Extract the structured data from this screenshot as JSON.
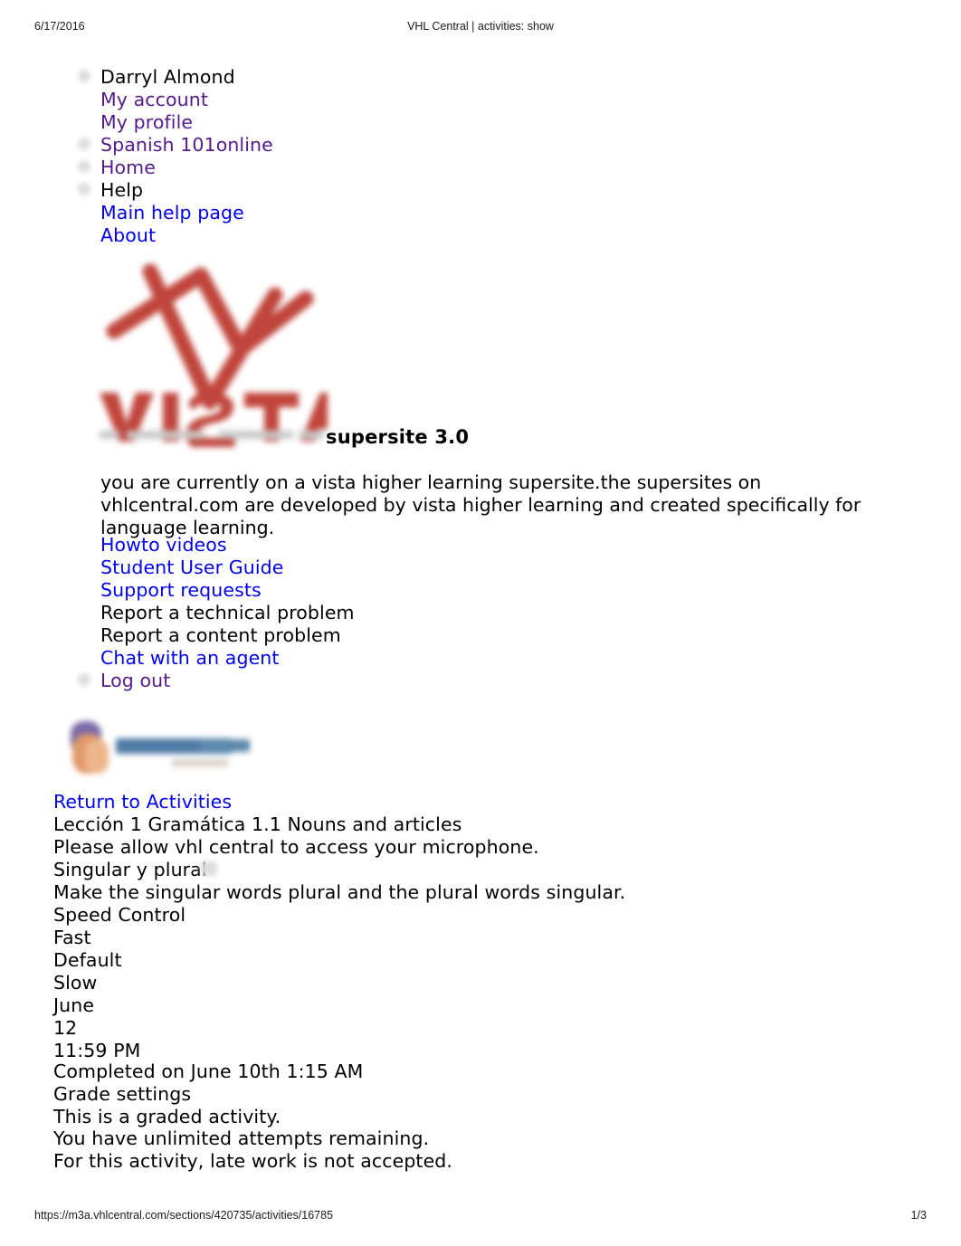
{
  "print_header": {
    "date": "6/17/2016",
    "title": "VHL Central | activities: show"
  },
  "print_footer": {
    "url": "https://m3a.vhlcentral.com/sections/420735/activities/16785",
    "page": "1/3"
  },
  "colors": {
    "link_unvisited": "#0000ee",
    "link_visited": "#551a8b",
    "text": "#000000",
    "logo_red": "#c0453c"
  },
  "nav": {
    "items": [
      {
        "label": "Darryl Almond",
        "kind": "text",
        "bullet": true
      },
      {
        "label": "My account",
        "kind": "visited",
        "bullet": false
      },
      {
        "label": "My profile",
        "kind": "visited",
        "bullet": false
      },
      {
        "label": "Spanish 101online",
        "kind": "visited",
        "bullet": true
      },
      {
        "label": "Home",
        "kind": "visited",
        "bullet": true
      },
      {
        "label": "Help",
        "kind": "text",
        "bullet": true
      },
      {
        "label": "Main help page",
        "kind": "link",
        "bullet": false
      },
      {
        "label": "About",
        "kind": "link",
        "bullet": false
      }
    ]
  },
  "brand": {
    "logo_name": "vista-higher-learning-logo",
    "wordmark": "VISTA",
    "supersite_label": "supersite 3.0",
    "description": "you are currently on a vista higher learning supersite.the supersites on vhlcentral.com are developed by vista higher learning and created specifically for language learning."
  },
  "support": {
    "items": [
      {
        "label": "Howto videos",
        "kind": "link"
      },
      {
        "label": "Student User Guide",
        "kind": "link"
      },
      {
        "label": "Support requests",
        "kind": "link"
      },
      {
        "label": "Report a technical problem",
        "kind": "text"
      },
      {
        "label": "Report a content problem",
        "kind": "text"
      },
      {
        "label": "Chat with an agent",
        "kind": "link"
      },
      {
        "label": "Log out",
        "kind": "visited",
        "bullet": true
      }
    ]
  },
  "activity": {
    "badge_name": "course-badge-image",
    "return_link": "Return to Activities",
    "breadcrumb": "Lección 1 Gramática 1.1 Nouns and articles",
    "mic_notice": "Please allow vhl central to access your microphone.",
    "title": "Singular y plural",
    "instructions": "Make the singular words plural and the plural words singular.",
    "speed_control": {
      "label": "Speed Control",
      "options": [
        "Fast",
        "Default",
        "Slow"
      ]
    },
    "due": {
      "month": "June",
      "day": "12",
      "time": "11:59 PM"
    },
    "completed": "Completed on June 10th 1:15 AM",
    "grade_settings": {
      "label": "Grade settings",
      "graded": "This is a graded activity.",
      "attempts": "You have unlimited attempts remaining.",
      "late_work": "For this activity, late work is not accepted."
    }
  }
}
